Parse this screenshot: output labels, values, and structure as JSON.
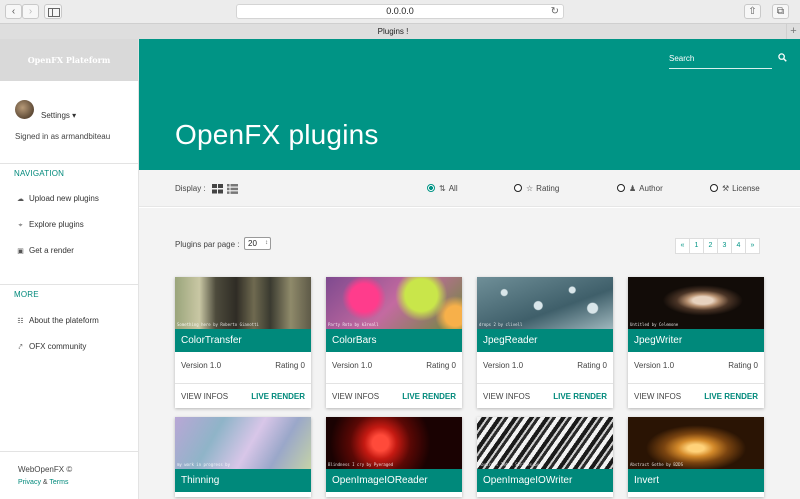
{
  "browser": {
    "url": "0.0.0.0",
    "tab_title": "Plugins !",
    "new_tab": "+"
  },
  "sidebar": {
    "brand": "OpenFX Plateform",
    "settings_label": "Settings ▾",
    "signed_in": "Signed in as armandbiteau",
    "navigation_title": "NAVIGATION",
    "nav_items": [
      {
        "label": "Upload new plugins",
        "icon": "cloud-upload-icon"
      },
      {
        "label": "Explore plugins",
        "icon": "crop-icon"
      },
      {
        "label": "Get a render",
        "icon": "image-icon"
      }
    ],
    "more_title": "MORE",
    "more_items": [
      {
        "label": "About the plateform",
        "icon": "sitemap-icon"
      },
      {
        "label": "OFX community",
        "icon": "share-icon"
      }
    ],
    "footer_copyright": "WebOpenFX ©",
    "footer_privacy": "Privacy",
    "footer_and": " & ",
    "footer_terms": "Terms"
  },
  "header": {
    "search_placeholder": "Search",
    "title": "OpenFX plugins"
  },
  "filters": {
    "display_label": "Display :",
    "options": [
      {
        "label": "All",
        "selected": true
      },
      {
        "label": "Rating",
        "selected": false
      },
      {
        "label": "Author",
        "selected": false
      },
      {
        "label": "License",
        "selected": false
      }
    ]
  },
  "main": {
    "per_page_label": "Plugins par page :",
    "per_page_value": "20",
    "pagination": [
      "«",
      "1",
      "2",
      "3",
      "4",
      "»"
    ],
    "view_infos": "VIEW INFOS",
    "live_render": "LIVE RENDER",
    "plugins": [
      {
        "name": "ColorTransfer",
        "version": "Version 1.0",
        "rating": "Rating 0",
        "caption": "Something here by Roberto Gianotti"
      },
      {
        "name": "ColorBars",
        "version": "Version 1.0",
        "rating": "Rating 0",
        "caption": "Party Roto by k3reall"
      },
      {
        "name": "JpegReader",
        "version": "Version 1.0",
        "rating": "Rating 0",
        "caption": "drops 2 by clivell"
      },
      {
        "name": "JpegWriter",
        "version": "Version 1.0",
        "rating": "Rating 0",
        "caption": "Untitled by Celemone"
      },
      {
        "name": "Thinning",
        "caption": "my work in progress by"
      },
      {
        "name": "OpenImageIOReader",
        "caption": "Blindness I cry by Pyeraged"
      },
      {
        "name": "OpenImageIOWriter",
        "caption": "Abstract Zebra Stripes by"
      },
      {
        "name": "Invert",
        "caption": "Abstract Gothe by B2DS"
      }
    ]
  }
}
